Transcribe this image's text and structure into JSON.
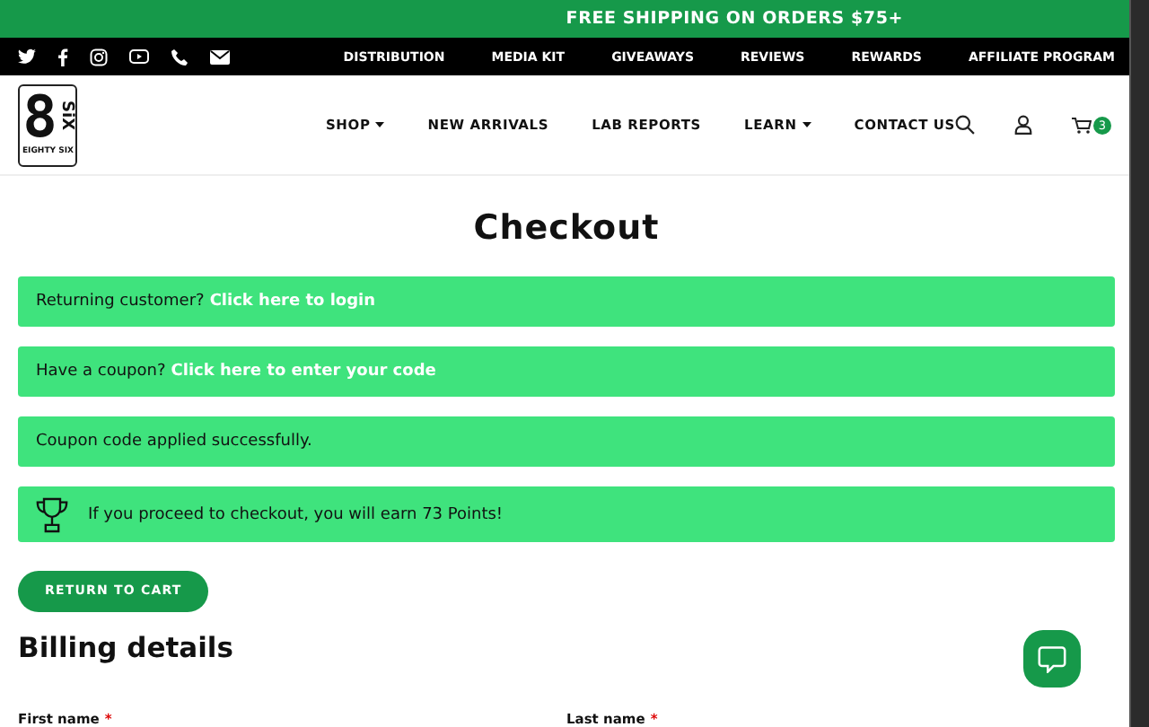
{
  "promo_bar": {
    "text": "FREE SHIPPING ON ORDERS $75+"
  },
  "top_bar": {
    "links": [
      "DISTRIBUTION",
      "MEDIA KIT",
      "GIVEAWAYS",
      "REVIEWS",
      "REWARDS",
      "AFFILIATE PROGRAM"
    ]
  },
  "header": {
    "logo": {
      "numeral": "8",
      "word": "SiX",
      "caption": "EIGHTY SIX"
    },
    "nav": [
      {
        "label": "SHOP",
        "dropdown": true
      },
      {
        "label": "NEW ARRIVALS",
        "dropdown": false
      },
      {
        "label": "LAB REPORTS",
        "dropdown": false
      },
      {
        "label": "LEARN",
        "dropdown": true
      },
      {
        "label": "CONTACT US",
        "dropdown": false
      }
    ],
    "cart_count": "3"
  },
  "page_title": "Checkout",
  "notices": [
    {
      "kind": "link",
      "text": "Returning customer?",
      "link": "Click here to login"
    },
    {
      "kind": "link",
      "text": "Have a coupon?",
      "link": "Click here to enter your code"
    },
    {
      "kind": "plain",
      "text": "Coupon code applied successfully."
    },
    {
      "kind": "reward",
      "text": "If you proceed to checkout, you will earn 73 Points!"
    }
  ],
  "return_button": "RETURN TO CART",
  "billing": {
    "heading": "Billing details",
    "fields": [
      {
        "label": "First name",
        "required_mark": "*"
      },
      {
        "label": "Last name",
        "required_mark": "*"
      }
    ]
  }
}
